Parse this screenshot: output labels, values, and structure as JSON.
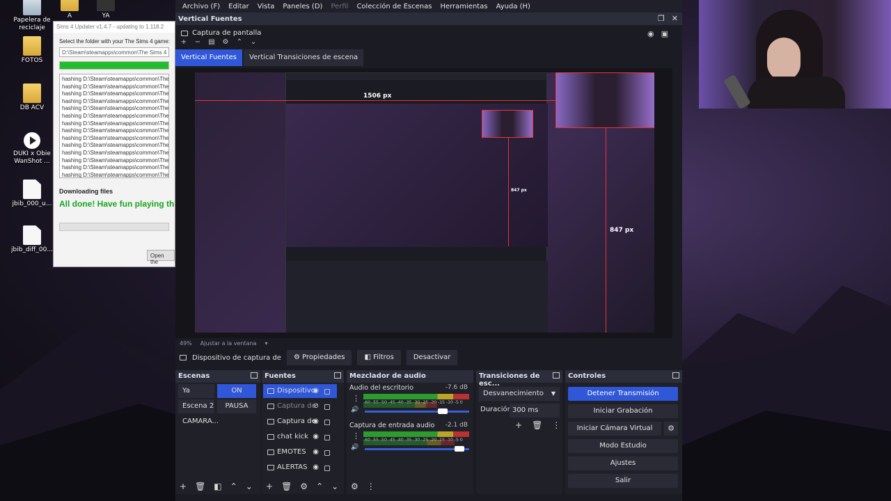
{
  "desktop": {
    "icons": [
      {
        "label": "Papelera de reciclaje",
        "kind": "bin-icon"
      },
      {
        "label": "A",
        "kind": "folder-icon"
      },
      {
        "label": "YA",
        "kind": "folder-icon"
      },
      {
        "label": "FOTOS",
        "kind": "folder-icon"
      },
      {
        "label": "DB ACV",
        "kind": "folder-icon"
      },
      {
        "label": "DUKI x Obie WanShot ...",
        "kind": "media-icon"
      },
      {
        "label": "jbib_000_u...",
        "kind": "file-icon"
      },
      {
        "label": "jbib_diff_00...",
        "kind": "file-icon"
      }
    ]
  },
  "updater": {
    "title": "Sims 4 Updater v1.4.7 - updating to 1.118.2",
    "prompt": "Select the folder with your The Sims 4 game:",
    "path": "D:\\Steam\\steamapps\\common\\The Sims 4",
    "progress": 1.0,
    "log_line": "hashing D:\\Steam\\steamapps\\common\\The",
    "log_count": 15,
    "downloading": "Downloading files",
    "done": "All done! Have fun playing th",
    "open_button": "Open the"
  },
  "obs": {
    "menu": [
      {
        "label": "Archivo (F)",
        "disabled": false
      },
      {
        "label": "Editar",
        "disabled": false
      },
      {
        "label": "Vista",
        "disabled": false
      },
      {
        "label": "Paneles (D)",
        "disabled": false
      },
      {
        "label": "Perfil",
        "disabled": true
      },
      {
        "label": "Colección de Escenas",
        "disabled": false
      },
      {
        "label": "Herramientas",
        "disabled": false
      },
      {
        "label": "Ayuda (H)",
        "disabled": false
      }
    ],
    "dock_title": "Vertical Fuentes",
    "capture_source": "Captura de pantalla",
    "tabs": [
      "Vertical Fuentes",
      "Vertical Transiciones de escena"
    ],
    "preview": {
      "width_label": "1506 px",
      "height_label": "847 px",
      "height_label_small": "847 px"
    },
    "zoom": {
      "percent": "49%",
      "fit": "Ajustar a la ventana"
    },
    "context": {
      "source_name": "Dispositivo de captura de v",
      "properties": "Propiedades",
      "filters": "Filtros",
      "deactivate": "Desactivar"
    },
    "scenes": {
      "title": "Escenas",
      "items": [
        "Ya come...",
        "Escena 2",
        "CAMARA..."
      ],
      "on_label": "ON",
      "pause_label": "PAUSA"
    },
    "sources": {
      "title": "Fuentes",
      "items": [
        {
          "name": "Dispositivo",
          "selected": true,
          "hidden": false
        },
        {
          "name": "Captura de",
          "selected": false,
          "hidden": true
        },
        {
          "name": "Captura de",
          "selected": false,
          "hidden": false
        },
        {
          "name": "chat kick",
          "selected": false,
          "hidden": false
        },
        {
          "name": "EMOTES",
          "selected": false,
          "hidden": false
        },
        {
          "name": "ALERTAS",
          "selected": false,
          "hidden": false
        }
      ]
    },
    "mixer": {
      "title": "Mezclador de audio",
      "scale": "-60 -55 -50 -45 -40 -35 -30 -25 -20 -15 -10 -5 0",
      "channels": [
        {
          "name": "Audio del escritorio",
          "db": "-7.6 dB",
          "level": 0.7
        },
        {
          "name": "Captura de entrada audio",
          "db": "-2.1 dB",
          "level": 0.86
        }
      ]
    },
    "transitions": {
      "title": "Transiciones de esc...",
      "selected": "Desvanecimiento",
      "duration_label": "Duración",
      "duration": "300 ms"
    },
    "controls": {
      "title": "Controles",
      "buttons": [
        "Detener Transmisión",
        "Iniciar Grabación",
        "Iniciar Cámara Virtual",
        "Modo Estudio",
        "Ajustes",
        "Salir"
      ]
    }
  },
  "colors": {
    "accent": "#2f57d8",
    "measure": "#e33333",
    "done_text": "#17a61d"
  }
}
